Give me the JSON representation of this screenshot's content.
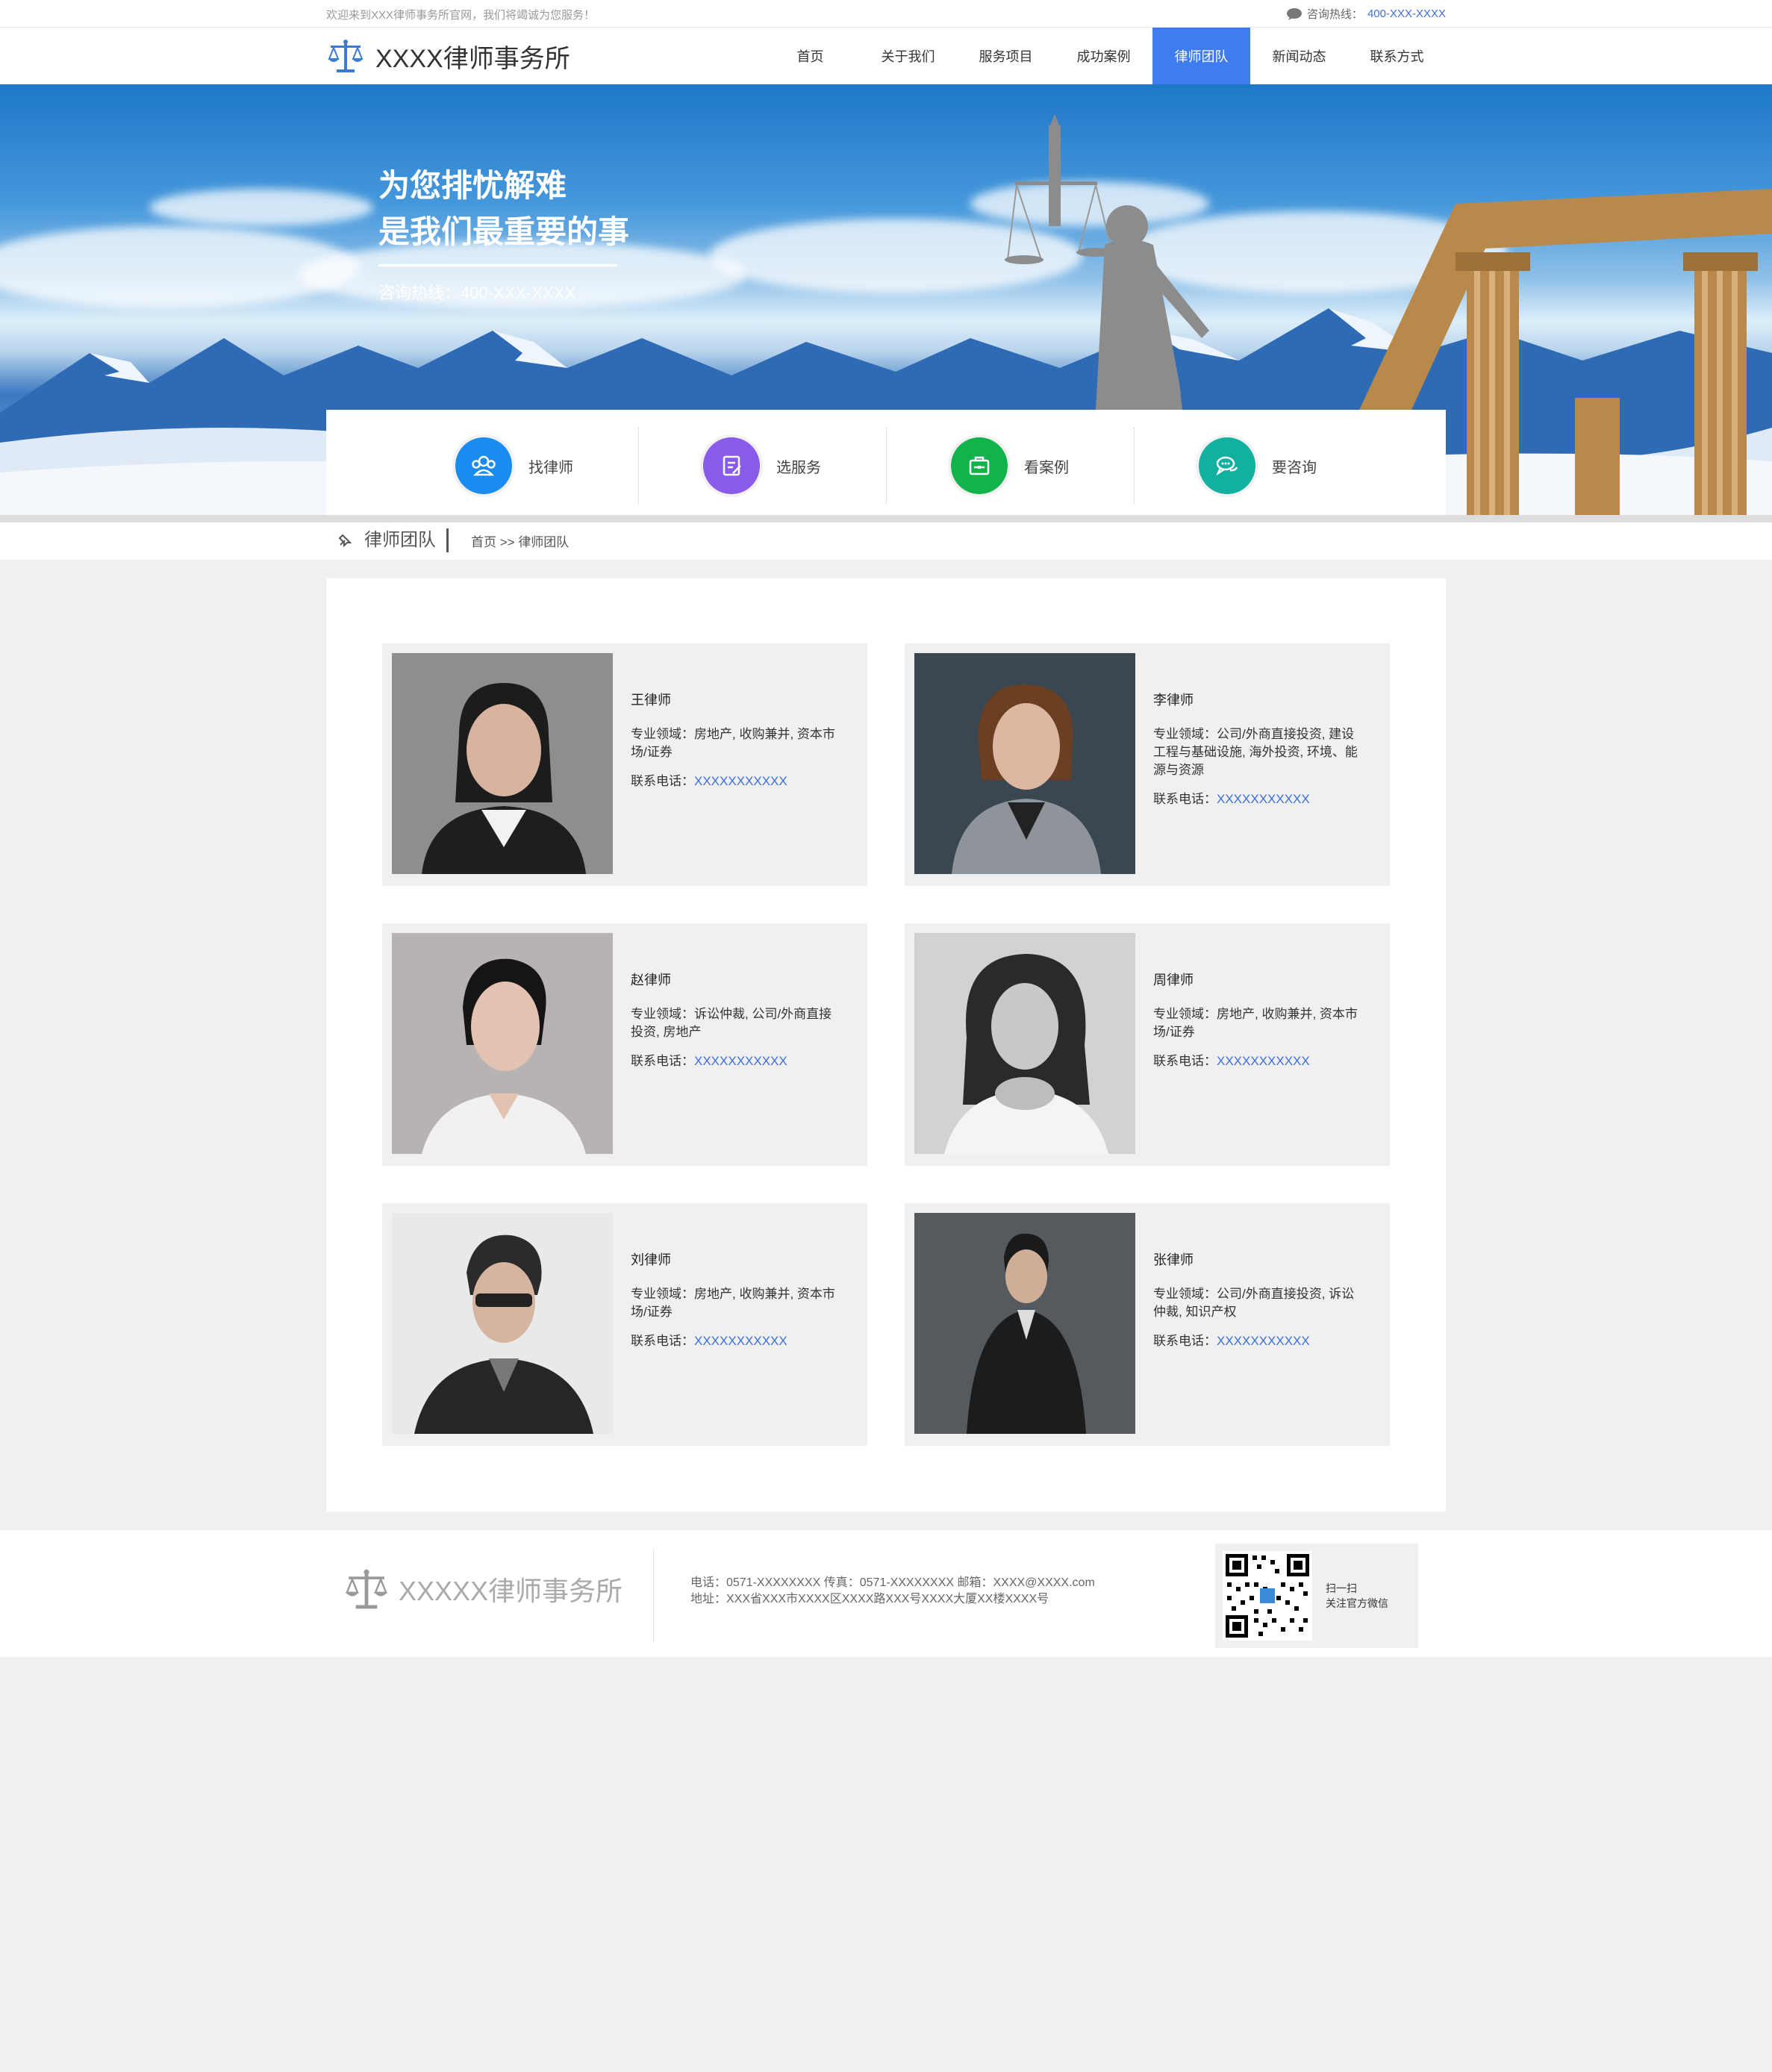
{
  "topbar": {
    "welcome": "欢迎来到XXX律师事务所官网，我们将竭诚为您服务！",
    "hotline_label": "咨询热线：",
    "hotline_number": "400-XXX-XXXX"
  },
  "header": {
    "logo_text": "XXXX律师事务所",
    "nav": [
      "首页",
      "关于我们",
      "服务项目",
      "成功案例",
      "律师团队",
      "新闻动态",
      "联系方式"
    ],
    "active_nav": "律师团队"
  },
  "banner": {
    "line1": "为您排忧解难",
    "line2": "是我们最重要的事",
    "hotline": "咨询热线：400-XXX-XXXX"
  },
  "quicklinks": [
    {
      "label": "找律师",
      "icon": "people-icon",
      "color": "#1a8cf0"
    },
    {
      "label": "选服务",
      "icon": "document-icon",
      "color": "#8a5ae8"
    },
    {
      "label": "看案例",
      "icon": "briefcase-icon",
      "color": "#12b34a"
    },
    {
      "label": "要咨询",
      "icon": "chat-icon",
      "color": "#12b0a0"
    }
  ],
  "breadcrumb": {
    "title": "律师团队",
    "path": "首页 >> 律师团队"
  },
  "lawyers": [
    {
      "name": "王律师",
      "field": "专业领域：房地产, 收购兼并, 资本市场/证券",
      "phone_label": "联系电话：",
      "phone": "XXXXXXXXXXX"
    },
    {
      "name": "李律师",
      "field": "专业领域：公司/外商直接投资, 建设工程与基础设施, 海外投资, 环境、能源与资源",
      "phone_label": "联系电话：",
      "phone": "XXXXXXXXXXX"
    },
    {
      "name": "赵律师",
      "field": "专业领域：诉讼仲裁, 公司/外商直接投资, 房地产",
      "phone_label": "联系电话：",
      "phone": "XXXXXXXXXXX"
    },
    {
      "name": "周律师",
      "field": "专业领域：房地产, 收购兼并, 资本市场/证券",
      "phone_label": "联系电话：",
      "phone": "XXXXXXXXXXX"
    },
    {
      "name": "刘律师",
      "field": "专业领域：房地产, 收购兼并, 资本市场/证券",
      "phone_label": "联系电话：",
      "phone": "XXXXXXXXXXX"
    },
    {
      "name": "张律师",
      "field": "专业领域：公司/外商直接投资, 诉讼仲裁, 知识产权",
      "phone_label": "联系电话：",
      "phone": "XXXXXXXXXXX"
    }
  ],
  "footer": {
    "logo_text": "XXXXX律师事务所",
    "contact_line1": "电话：0571-XXXXXXXX 传真：0571-XXXXXXXX 邮箱：XXXX@XXXX.com",
    "contact_line2": "地址：XXX省XXX市XXXX区XXXX路XXX号XXXX大厦XX楼XXXX号",
    "qr_line1": "扫一扫",
    "qr_line2": "关注官方微信"
  },
  "colors": {
    "accent": "#3e7cf0",
    "link": "#3e6fd8"
  }
}
